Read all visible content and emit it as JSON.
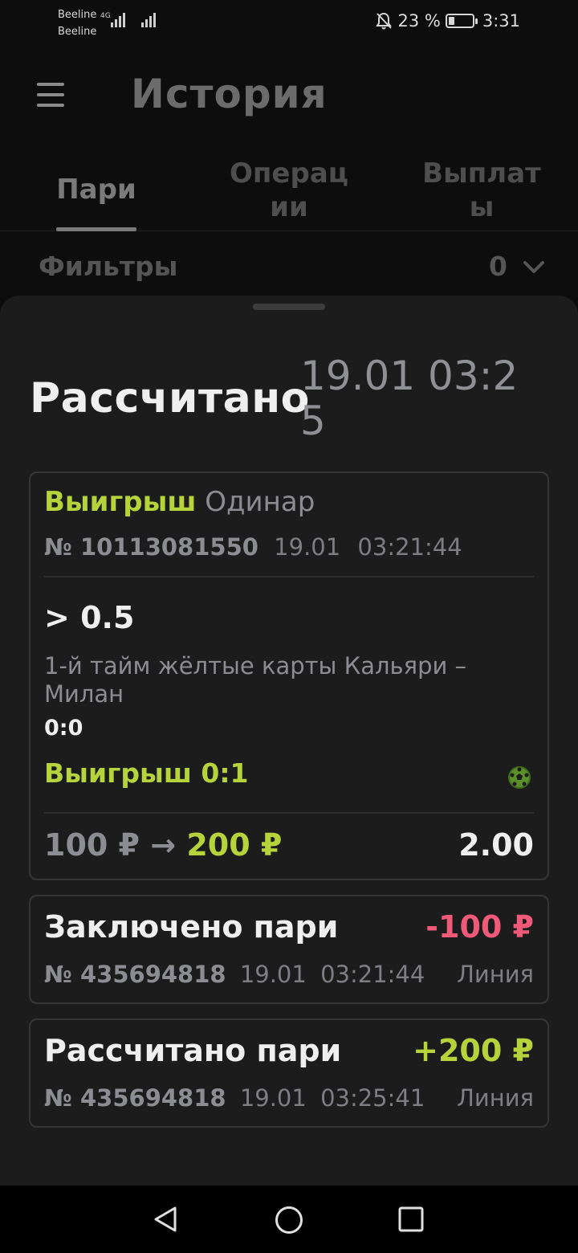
{
  "status_bar": {
    "carrier_1": "Beeline",
    "carrier_2": "Beeline",
    "network": "4G",
    "battery_percent": "23 %",
    "time": "3:31",
    "icons": [
      "signal-icon",
      "mute-bell-icon",
      "battery-icon"
    ]
  },
  "header": {
    "title": "История",
    "menu_icon": "hamburger-icon"
  },
  "tabs": [
    {
      "label": "Пари",
      "active": true
    },
    {
      "label": "Операц ии",
      "active": false
    },
    {
      "label": "Выплат ы",
      "active": false
    }
  ],
  "filters": {
    "label": "Фильтры",
    "count": "0",
    "icon": "chevron-down-icon"
  },
  "sheet": {
    "title": "Рассчитано",
    "date": "19.01 03:25"
  },
  "bet_card": {
    "status": "Выигрыш",
    "type": "Одинар",
    "number": "№ 10113081550",
    "date": "19.01",
    "time": "03:21:44",
    "outcome": "> 0.5",
    "event": "1-й тайм жёлтые карты Кальяри – Милан",
    "score": "0:0",
    "result": "Выигрыш 0:1",
    "sport_icon": "soccer-ball-icon",
    "stake": "100 ₽",
    "arrow": "→",
    "payout": "200 ₽",
    "coefficient": "2.00"
  },
  "operations": [
    {
      "title": "Заключено пари",
      "amount": "-100 ₽",
      "number": "№ 435694818",
      "date": "19.01",
      "time": "03:21:44",
      "source": "Линия"
    },
    {
      "title": "Рассчитано пари",
      "amount": "+200 ₽",
      "number": "№ 435694818",
      "date": "19.01",
      "time": "03:25:41",
      "source": "Линия"
    }
  ],
  "nav_bar": {
    "icons": [
      "back-icon",
      "home-icon",
      "recents-icon"
    ]
  },
  "colors": {
    "win": "#b6d33b",
    "loss": "#ee5a78",
    "sheet_bg": "#1c1c1c",
    "page_bg": "#0d0d0d"
  }
}
